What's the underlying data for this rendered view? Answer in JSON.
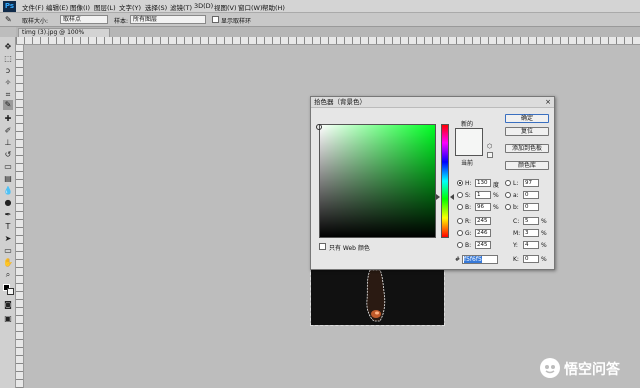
{
  "app": {
    "logo": "Ps"
  },
  "menu": [
    "文件(F)",
    "编辑(E)",
    "图像(I)",
    "图层(L)",
    "文字(Y)",
    "选择(S)",
    "滤镜(T)",
    "3D(D)",
    "视图(V)",
    "窗口(W)",
    "帮助(H)"
  ],
  "options": {
    "sample_size_label": "取样大小:",
    "sample_size_value": "取样点",
    "sample_label": "样本:",
    "sample_value": "所有图层",
    "show_ring_label": "显示取样环"
  },
  "document": {
    "tab_title": "timg (3).jpg @ 100%(RGB/8#) *",
    "tab_close": "×"
  },
  "dialog": {
    "title": "拾色器（背景色）",
    "close": "×",
    "new_label": "新的",
    "current_label": "当前",
    "buttons": {
      "ok": "确定",
      "reset": "复位",
      "add_swatch": "添加到色板",
      "color_library": "颜色库"
    },
    "web_only_label": "只有 Web 颜色",
    "fields": {
      "H": {
        "label": "H:",
        "value": "130",
        "unit": "度"
      },
      "S": {
        "label": "S:",
        "value": "1",
        "unit": "%"
      },
      "B": {
        "label": "B:",
        "value": "96",
        "unit": "%"
      },
      "R": {
        "label": "R:",
        "value": "245"
      },
      "G": {
        "label": "G:",
        "value": "246"
      },
      "Bb": {
        "label": "B:",
        "value": "245"
      },
      "L": {
        "label": "L:",
        "value": "97"
      },
      "a": {
        "label": "a:",
        "value": "0"
      },
      "b": {
        "label": "b:",
        "value": "0"
      },
      "C": {
        "label": "C:",
        "value": "5",
        "unit": "%"
      },
      "M": {
        "label": "M:",
        "value": "3",
        "unit": "%"
      },
      "Y": {
        "label": "Y:",
        "value": "4",
        "unit": "%"
      },
      "K": {
        "label": "K:",
        "value": "0",
        "unit": "%"
      }
    },
    "hex_label": "#",
    "hex_value": "f5f6f5",
    "colors": {
      "new": "#f5f6f5",
      "current": "#f5f6f5"
    }
  },
  "watermark": {
    "text": "悟空问答"
  }
}
